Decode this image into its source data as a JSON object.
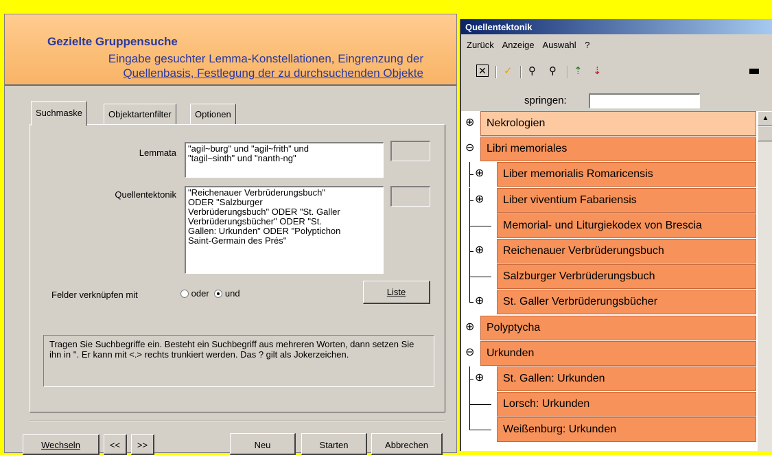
{
  "dialog": {
    "title": "Gezielte Gruppensuche",
    "subtitle_line1": "Eingabe gesuchter Lemma-Konstellationen, Eingrenzung der",
    "subtitle_line2": "Quellenbasis, Festlegung der zu durchsuchenden Objekte",
    "tabs": [
      "Suchmaske",
      "Objektartenfilter",
      "Optionen"
    ],
    "lemmata_label": "Lemmata",
    "lemmata_value": "\"agil~burg\" und \"agil~frith\" und\n\"tagil~sinth\" und \"nanth-ng\"",
    "quellen_label": "Quellentektonik",
    "quellen_value": "\"Reichenauer Verbrüderungsbuch\"\nODER \"Salzburger\nVerbrüderungsbuch\" ODER \"St. Galler\nVerbrüderungsbücher\" ODER \"St.\nGallen: Urkunden\" ODER \"Polyptichon\nSaint-Germain des Prés\"",
    "link_label": "Felder verknüpfen mit",
    "radio_or": "oder",
    "radio_and": "und",
    "list_button": "Liste",
    "hint": "Tragen Sie Suchbegriffe ein. Besteht ein Suchbegriff aus mehreren Worten, dann setzen Sie ihn in ''. Er kann mit <.> rechts trunkiert werden. Das ? gilt als Jokerzeichen.",
    "buttons": {
      "wechseln": "Wechseln",
      "prev": "<<",
      "next": ">>",
      "neu": "Neu",
      "starten": "Starten",
      "abbrechen": "Abbrechen"
    }
  },
  "panel": {
    "title": "Quellentektonik",
    "menu": [
      "Zurück",
      "Anzeige",
      "Auswahl",
      "?"
    ],
    "jump_label": "springen:",
    "tree": [
      {
        "label": "Nekrologien",
        "expander": "⊕",
        "level": 0
      },
      {
        "label": "Libri memoriales",
        "expander": "⊖",
        "level": 0
      },
      {
        "label": "Liber memorialis Romaricensis",
        "expander": "⊕",
        "level": 1
      },
      {
        "label": "Liber viventium Fabariensis",
        "expander": "⊕",
        "level": 1
      },
      {
        "label": "Memorial- und Liturgiekodex von Brescia",
        "expander": "",
        "level": 1
      },
      {
        "label": "Reichenauer Verbrüderungsbuch",
        "expander": "⊕",
        "level": 1
      },
      {
        "label": "Salzburger Verbrüderungsbuch",
        "expander": "",
        "level": 1
      },
      {
        "label": "St. Galler Verbrüderungsbücher",
        "expander": "⊕",
        "level": 1
      },
      {
        "label": "Polyptycha",
        "expander": "⊕",
        "level": 0
      },
      {
        "label": "Urkunden",
        "expander": "⊖",
        "level": 0
      },
      {
        "label": "St. Gallen: Urkunden",
        "expander": "⊕",
        "level": 1
      },
      {
        "label": "Lorsch: Urkunden",
        "expander": "",
        "level": 1
      },
      {
        "label": "Weißenburg: Urkunden",
        "expander": "",
        "level": 1
      }
    ]
  }
}
